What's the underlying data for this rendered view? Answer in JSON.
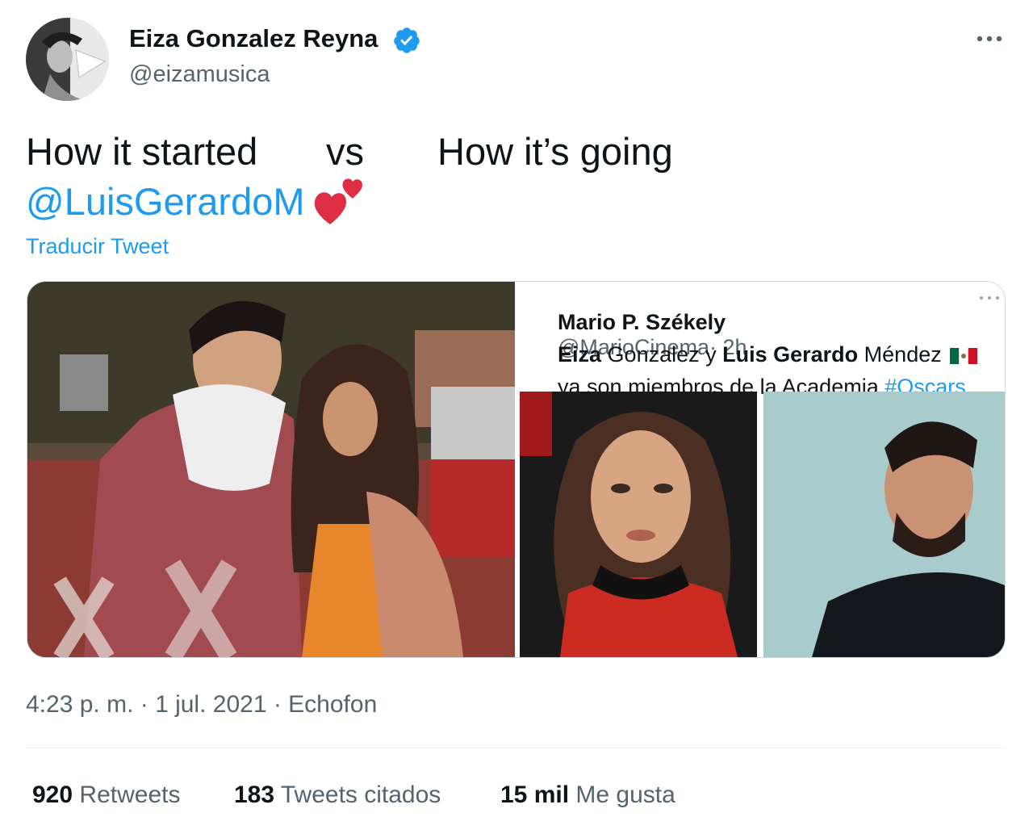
{
  "author": {
    "display_name": "Eiza Gonzalez Reyna",
    "handle": "@eizamusica",
    "verified": true,
    "avatar_icon": "profile-photo"
  },
  "tweet": {
    "text_left": "How it started",
    "text_vs": "vs",
    "text_right": "How it’s going",
    "mention": "@LuisGerardoM",
    "emoji": "two-hearts-icon",
    "translate_label": "Traducir Tweet"
  },
  "media": {
    "photo_left_alt": "photo-of-couple",
    "quoted_screenshot": {
      "author_name": "Mario P. Székely",
      "author_handle": "@MarioCinema",
      "time": "· 2h",
      "line2_a": "Eiza",
      "line2_b": " Gonzalez y ",
      "line2_c": "Luis Gerardo",
      "line2_d": " Méndez",
      "line3_text": "ya son miembros de la Academia ",
      "line3_hashtag": "#Oscars"
    }
  },
  "meta": {
    "timestamp": "4:23 p. m. · 1 jul. 2021 · Echofon"
  },
  "stats": {
    "retweets_count": "920",
    "retweets_label": "Retweets",
    "quotes_count": "183",
    "quotes_label": "Tweets citados",
    "likes_count": "15 mil",
    "likes_label": "Me gusta"
  },
  "colors": {
    "accent": "#1d9bf0",
    "muted": "#536471",
    "text": "#0f1419"
  }
}
